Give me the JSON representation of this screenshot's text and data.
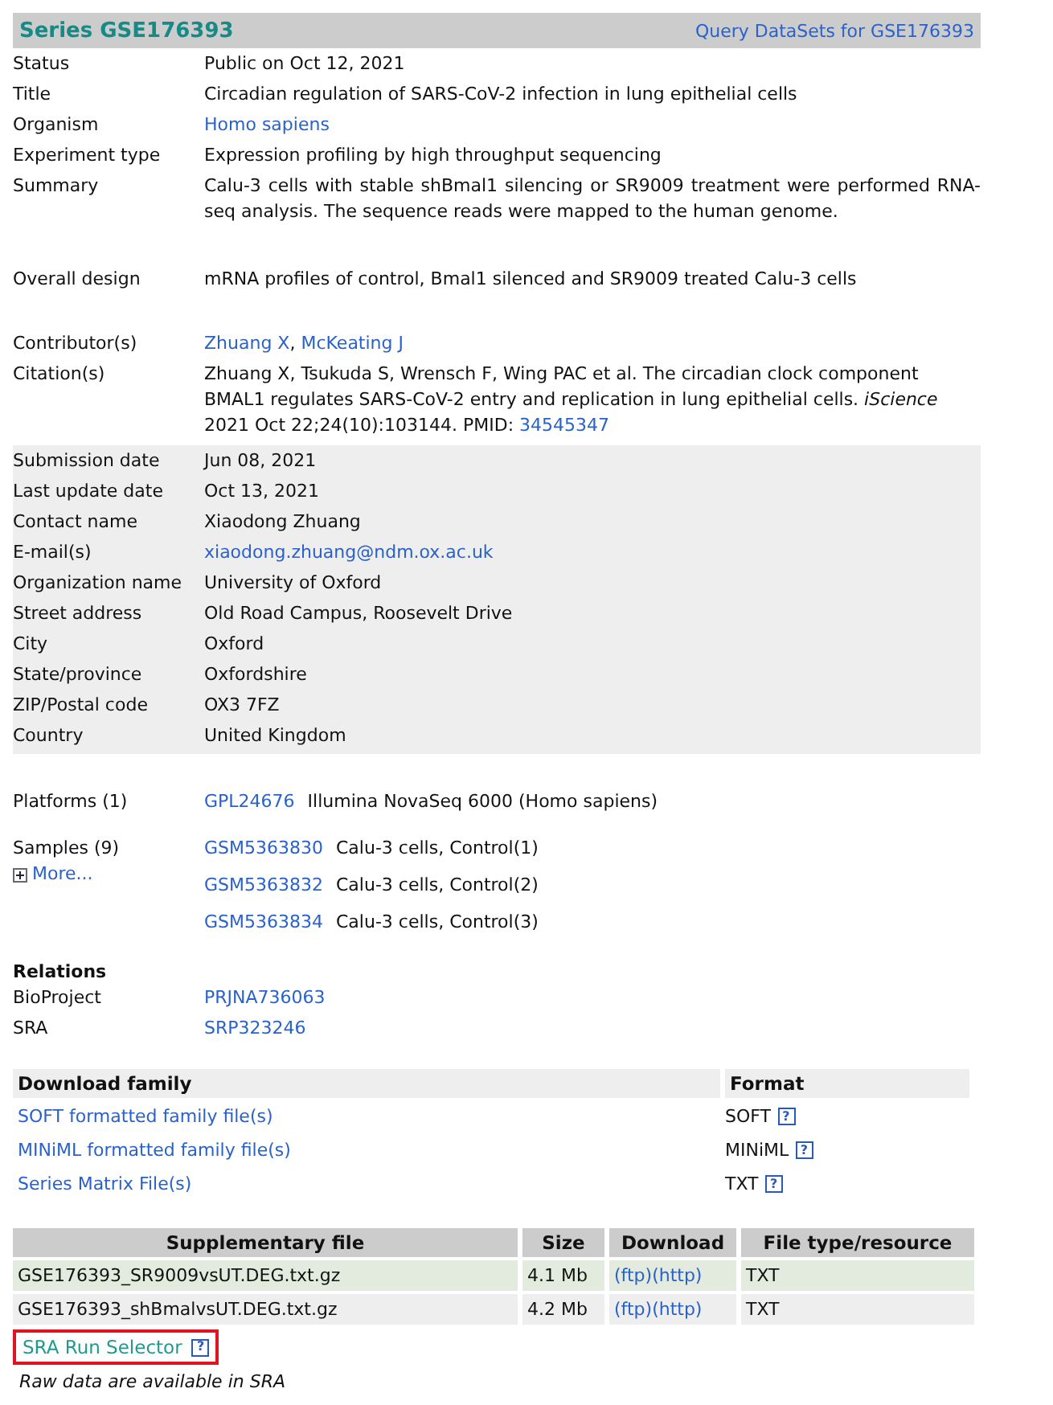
{
  "header": {
    "title": "Series GSE176393",
    "query_link": "Query DataSets for GSE176393"
  },
  "field_groups": [
    {
      "shaded": false,
      "rows": [
        {
          "label": "Status",
          "segments": [
            {
              "kind": "text",
              "text": "Public on Oct 12, 2021"
            }
          ]
        },
        {
          "label": "Title",
          "segments": [
            {
              "kind": "text",
              "text": "Circadian regulation of SARS-CoV-2 infection in lung epithelial cells"
            }
          ]
        },
        {
          "label": "Organism",
          "segments": [
            {
              "kind": "link",
              "text": "Homo sapiens"
            }
          ]
        },
        {
          "label": "Experiment type",
          "segments": [
            {
              "kind": "text",
              "text": "Expression profiling by high throughput sequencing"
            }
          ]
        },
        {
          "label": "Summary",
          "justified": true,
          "segments": [
            {
              "kind": "text",
              "text": "Calu-3 cells with stable shBmal1 silencing or SR9009 treatment were performed RNA-seq analysis. The sequence reads were mapped to the human genome."
            }
          ]
        }
      ]
    },
    {
      "shaded": false,
      "rows": [
        {
          "label": "Overall design",
          "segments": [
            {
              "kind": "text",
              "text": "mRNA profiles of control, Bmal1 silenced and SR9009 treated Calu-3 cells"
            }
          ]
        }
      ]
    },
    {
      "shaded": false,
      "rows": [
        {
          "label": "Contributor(s)",
          "segments": [
            {
              "kind": "link",
              "text": "Zhuang X"
            },
            {
              "kind": "text",
              "text": ", "
            },
            {
              "kind": "link",
              "text": "McKeating J"
            }
          ]
        },
        {
          "label": "Citation(s)",
          "segments": [
            {
              "kind": "text",
              "text": "Zhuang X, Tsukuda S, Wrensch F, Wing PAC et al. The circadian clock component BMAL1 regulates SARS-CoV-2 entry and replication in lung epithelial cells. *iScience* 2021 Oct 22;24(10):103144. PMID: "
            },
            {
              "kind": "link",
              "text": "34545347"
            }
          ]
        }
      ]
    },
    {
      "shaded": true,
      "rows": [
        {
          "label": "Submission date",
          "segments": [
            {
              "kind": "text",
              "text": "Jun 08, 2021"
            }
          ]
        },
        {
          "label": "Last update date",
          "segments": [
            {
              "kind": "text",
              "text": "Oct 13, 2021"
            }
          ]
        },
        {
          "label": "Contact name",
          "segments": [
            {
              "kind": "text",
              "text": "Xiaodong Zhuang"
            }
          ]
        },
        {
          "label": "E-mail(s)",
          "segments": [
            {
              "kind": "link",
              "text": "xiaodong.zhuang@ndm.ox.ac.uk"
            }
          ]
        },
        {
          "label": "Organization name",
          "segments": [
            {
              "kind": "text",
              "text": "University of Oxford"
            }
          ]
        },
        {
          "label": "Street address",
          "segments": [
            {
              "kind": "text",
              "text": "Old Road Campus, Roosevelt Drive"
            }
          ]
        },
        {
          "label": "City",
          "segments": [
            {
              "kind": "text",
              "text": "Oxford"
            }
          ]
        },
        {
          "label": "State/province",
          "segments": [
            {
              "kind": "text",
              "text": "Oxfordshire"
            }
          ]
        },
        {
          "label": "ZIP/Postal code",
          "segments": [
            {
              "kind": "text",
              "text": "OX3 7FZ"
            }
          ]
        },
        {
          "label": "Country",
          "segments": [
            {
              "kind": "text",
              "text": "United Kingdom"
            }
          ]
        }
      ]
    }
  ],
  "platforms": {
    "label": "Platforms (1)",
    "items": [
      {
        "accession": "GPL24676",
        "description": "Illumina NovaSeq 6000 (Homo sapiens)"
      }
    ]
  },
  "samples": {
    "label": "Samples (9)",
    "more": "More...",
    "items": [
      {
        "accession": "GSM5363830",
        "description": "Calu-3 cells, Control(1)"
      },
      {
        "accession": "GSM5363832",
        "description": "Calu-3 cells, Control(2)"
      },
      {
        "accession": "GSM5363834",
        "description": "Calu-3 cells, Control(3)"
      }
    ]
  },
  "relations": {
    "title": "Relations",
    "rows": [
      {
        "label": "BioProject",
        "value": "PRJNA736063"
      },
      {
        "label": "SRA",
        "value": "SRP323246"
      }
    ]
  },
  "download_family": {
    "columns": [
      "Download family",
      "Format"
    ],
    "rows": [
      {
        "link": "SOFT formatted family file(s)",
        "format": "SOFT",
        "help": "?"
      },
      {
        "link": "MINiML formatted family file(s)",
        "format": "MINiML",
        "help": "?"
      },
      {
        "link": "Series Matrix File(s)",
        "format": "TXT",
        "help": "?"
      }
    ]
  },
  "supplementary": {
    "columns": [
      "Supplementary file",
      "Size",
      "Download",
      "File type/resource"
    ],
    "rows": [
      {
        "file": "GSE176393_SR9009vsUT.DEG.txt.gz",
        "size": "4.1 Mb",
        "ftp": "(ftp)",
        "http": "(http)",
        "type": "TXT",
        "highlighted": true
      },
      {
        "file": "GSE176393_shBmalvsUT.DEG.txt.gz",
        "size": "4.2 Mb",
        "ftp": "(ftp)",
        "http": "(http)",
        "type": "TXT",
        "highlighted": false
      }
    ]
  },
  "sra_run_selector": {
    "label": "SRA Run Selector",
    "help": "?",
    "highlighted": true
  },
  "raw_note": "Raw data are available in SRA"
}
